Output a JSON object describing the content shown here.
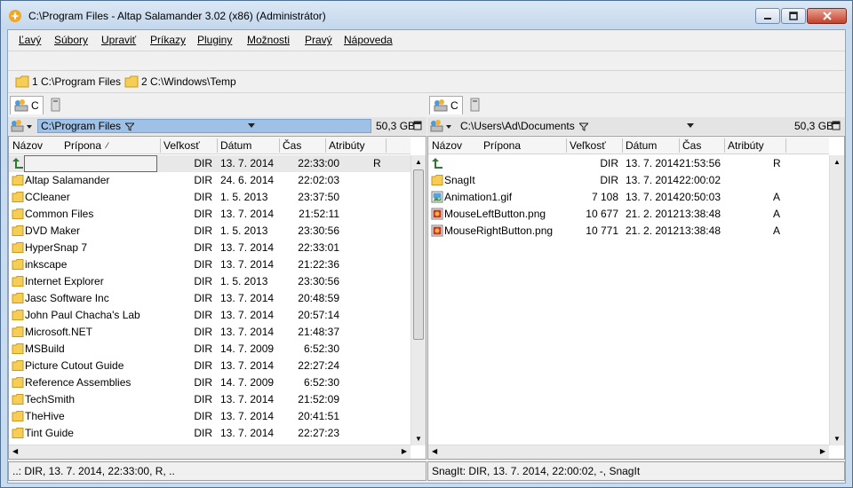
{
  "window": {
    "title": "C:\\Program Files - Altap Salamander 3.02 (x86) (Administrátor)"
  },
  "menu": [
    "Ľavý",
    "Súbory",
    "Upraviť",
    "Príkazy",
    "Pluginy",
    "Možnosti",
    "Pravý",
    "Nápoveda"
  ],
  "hotpaths": [
    "1 C:\\Program Files",
    "2 C:\\Windows\\Temp"
  ],
  "left": {
    "drive_tab": "C",
    "path": "C:\\Program Files",
    "free": "50,3 GB",
    "columns": [
      "Názov",
      "Prípona",
      "Veľkosť",
      "Dátum",
      "Čas",
      "Atribúty"
    ],
    "rows": [
      {
        "name": "",
        "type": "up",
        "size": "DIR",
        "date": "13. 7. 2014",
        "time": "22:33:00",
        "attr": "R"
      },
      {
        "name": "Altap Salamander",
        "type": "folder",
        "size": "DIR",
        "date": "24. 6. 2014",
        "time": "22:02:03",
        "attr": ""
      },
      {
        "name": "CCleaner",
        "type": "folder",
        "size": "DIR",
        "date": "1. 5. 2013",
        "time": "23:37:50",
        "attr": ""
      },
      {
        "name": "Common Files",
        "type": "folder",
        "size": "DIR",
        "date": "13. 7. 2014",
        "time": "21:52:11",
        "attr": ""
      },
      {
        "name": "DVD Maker",
        "type": "folder",
        "size": "DIR",
        "date": "1. 5. 2013",
        "time": "23:30:56",
        "attr": ""
      },
      {
        "name": "HyperSnap 7",
        "type": "folder",
        "size": "DIR",
        "date": "13. 7. 2014",
        "time": "22:33:01",
        "attr": ""
      },
      {
        "name": "inkscape",
        "type": "folder",
        "size": "DIR",
        "date": "13. 7. 2014",
        "time": "21:22:36",
        "attr": ""
      },
      {
        "name": "Internet Explorer",
        "type": "folder",
        "size": "DIR",
        "date": "1. 5. 2013",
        "time": "23:30:56",
        "attr": ""
      },
      {
        "name": "Jasc Software Inc",
        "type": "folder",
        "size": "DIR",
        "date": "13. 7. 2014",
        "time": "20:48:59",
        "attr": ""
      },
      {
        "name": "John Paul Chacha's Lab",
        "type": "folder",
        "size": "DIR",
        "date": "13. 7. 2014",
        "time": "20:57:14",
        "attr": ""
      },
      {
        "name": "Microsoft.NET",
        "type": "folder",
        "size": "DIR",
        "date": "13. 7. 2014",
        "time": "21:48:37",
        "attr": ""
      },
      {
        "name": "MSBuild",
        "type": "folder",
        "size": "DIR",
        "date": "14. 7. 2009",
        "time": "6:52:30",
        "attr": ""
      },
      {
        "name": "Picture Cutout Guide",
        "type": "folder",
        "size": "DIR",
        "date": "13. 7. 2014",
        "time": "22:27:24",
        "attr": ""
      },
      {
        "name": "Reference Assemblies",
        "type": "folder",
        "size": "DIR",
        "date": "14. 7. 2009",
        "time": "6:52:30",
        "attr": ""
      },
      {
        "name": "TechSmith",
        "type": "folder",
        "size": "DIR",
        "date": "13. 7. 2014",
        "time": "21:52:09",
        "attr": ""
      },
      {
        "name": "TheHive",
        "type": "folder",
        "size": "DIR",
        "date": "13. 7. 2014",
        "time": "20:41:51",
        "attr": ""
      },
      {
        "name": "Tint Guide",
        "type": "folder",
        "size": "DIR",
        "date": "13. 7. 2014",
        "time": "22:27:23",
        "attr": ""
      }
    ],
    "status": "..: DIR, 13. 7. 2014, 22:33:00, R, .."
  },
  "right": {
    "drive_tab": "C",
    "path": "C:\\Users\\Ad\\Documents",
    "free": "50,3 GB",
    "columns": [
      "Názov",
      "Prípona",
      "Veľkosť",
      "Dátum",
      "Čas",
      "Atribúty"
    ],
    "rows": [
      {
        "name": "",
        "type": "up",
        "size": "DIR",
        "date": "13. 7. 2014",
        "time": "21:53:56",
        "attr": "R"
      },
      {
        "name": "SnagIt",
        "type": "folder",
        "size": "DIR",
        "date": "13. 7. 2014",
        "time": "22:00:02",
        "attr": ""
      },
      {
        "name": "Animation1.gif",
        "type": "gif",
        "size": "7 108",
        "date": "13. 7. 2014",
        "time": "20:50:03",
        "attr": "A"
      },
      {
        "name": "MouseLeftButton.png",
        "type": "png",
        "size": "10 677",
        "date": "21. 2. 2012",
        "time": "13:38:48",
        "attr": "A"
      },
      {
        "name": "MouseRightButton.png",
        "type": "png",
        "size": "10 771",
        "date": "21. 2. 2012",
        "time": "13:38:48",
        "attr": "A"
      }
    ],
    "status": "SnagIt: DIR, 13. 7. 2014, 22:00:02, -, SnagIt"
  }
}
